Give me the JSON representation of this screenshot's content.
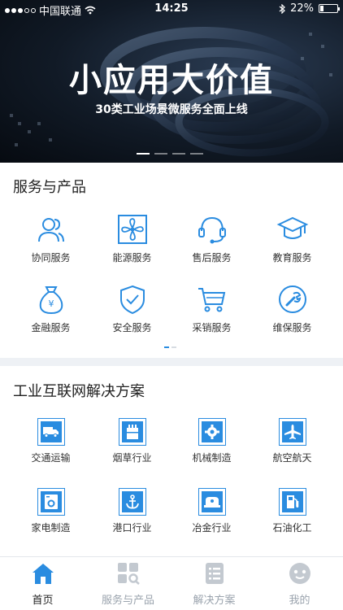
{
  "status": {
    "carrier": "中国联通",
    "time": "14:25",
    "battery": "22%",
    "battery_level": 0.22
  },
  "hero": {
    "title": "小应用大价值",
    "subtitle": "30类工业场景微服务全面上线"
  },
  "services": {
    "title": "服务与产品",
    "items": [
      {
        "label": "协同服务",
        "icon": "users-icon"
      },
      {
        "label": "能源服务",
        "icon": "fan-icon"
      },
      {
        "label": "售后服务",
        "icon": "headset-icon"
      },
      {
        "label": "教育服务",
        "icon": "graduation-cap-icon"
      },
      {
        "label": "金融服务",
        "icon": "money-bag-icon"
      },
      {
        "label": "安全服务",
        "icon": "shield-icon"
      },
      {
        "label": "采销服务",
        "icon": "cart-icon"
      },
      {
        "label": "维保服务",
        "icon": "wrench-icon"
      }
    ]
  },
  "solutions": {
    "title": "工业互联网解决方案",
    "items": [
      {
        "label": "交通运输",
        "icon": "truck-icon"
      },
      {
        "label": "烟草行业",
        "icon": "tobacco-icon"
      },
      {
        "label": "机械制造",
        "icon": "gear-icon"
      },
      {
        "label": "航空航天",
        "icon": "airplane-icon"
      },
      {
        "label": "家电制造",
        "icon": "washer-icon"
      },
      {
        "label": "港口行业",
        "icon": "anchor-icon"
      },
      {
        "label": "冶金行业",
        "icon": "furnace-icon"
      },
      {
        "label": "石油化工",
        "icon": "fuel-pump-icon"
      }
    ]
  },
  "tabbar": {
    "tabs": [
      {
        "label": "首页",
        "icon": "home-icon",
        "active": true
      },
      {
        "label": "服务与产品",
        "icon": "apps-search-icon",
        "active": false
      },
      {
        "label": "解决方案",
        "icon": "list-icon",
        "active": false
      },
      {
        "label": "我的",
        "icon": "face-icon",
        "active": false
      }
    ]
  },
  "colors": {
    "accent": "#2a8ce0",
    "tab_active": "#2a8ce0",
    "tab_inactive": "#c3c9d0"
  }
}
